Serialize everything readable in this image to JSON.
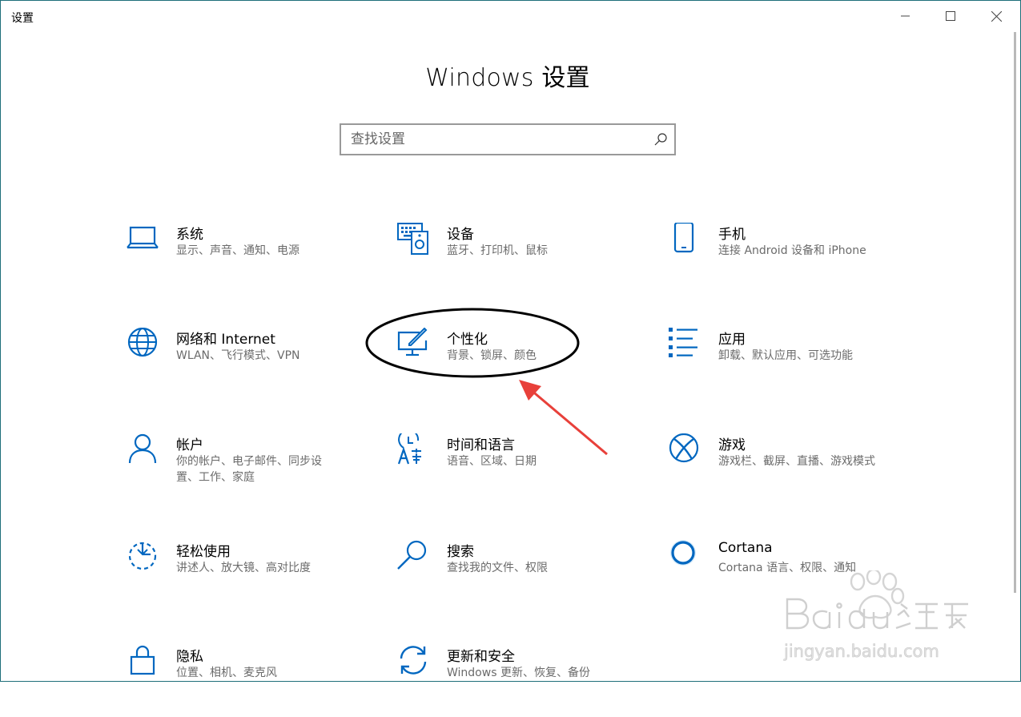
{
  "window": {
    "title": "设置",
    "controls": [
      "minimize-icon",
      "maximize-icon",
      "close-icon"
    ]
  },
  "page": {
    "title": "Windows 设置"
  },
  "search": {
    "placeholder": "查找设置",
    "value": ""
  },
  "colors": {
    "accent": "#0067c0",
    "annotation_ellipse": "#000000",
    "annotation_arrow": "#e8403a"
  },
  "tiles": [
    {
      "label": "系统",
      "desc": "显示、声音、通知、电源",
      "icon": "laptop-icon"
    },
    {
      "label": "设备",
      "desc": "蓝牙、打印机、鼠标",
      "icon": "keyboard-speaker-icon"
    },
    {
      "label": "手机",
      "desc": "连接 Android 设备和 iPhone",
      "icon": "phone-icon"
    },
    {
      "label": "网络和 Internet",
      "desc": "WLAN、飞行模式、VPN",
      "icon": "globe-icon"
    },
    {
      "label": "个性化",
      "desc": "背景、锁屏、颜色",
      "icon": "monitor-brush-icon"
    },
    {
      "label": "应用",
      "desc": "卸载、默认应用、可选功能",
      "icon": "app-list-icon"
    },
    {
      "label": "帐户",
      "desc": "你的帐户、电子邮件、同步设置、工作、家庭",
      "icon": "person-icon"
    },
    {
      "label": "时间和语言",
      "desc": "语音、区域、日期",
      "icon": "time-language-icon"
    },
    {
      "label": "游戏",
      "desc": "游戏栏、截屏、直播、游戏模式",
      "icon": "xbox-icon"
    },
    {
      "label": "轻松使用",
      "desc": "讲述人、放大镜、高对比度",
      "icon": "ease-of-access-icon"
    },
    {
      "label": "搜索",
      "desc": "查找我的文件、权限",
      "icon": "magnifier-icon"
    },
    {
      "label": "Cortana",
      "desc": "Cortana 语言、权限、通知",
      "icon": "cortana-icon"
    },
    {
      "label": "隐私",
      "desc": "位置、相机、麦克风",
      "icon": "lock-icon"
    },
    {
      "label": "更新和安全",
      "desc": "Windows 更新、恢复、备份",
      "icon": "refresh-icon"
    }
  ],
  "watermark": {
    "brand": "Bai du 经验",
    "url": "jingyan.baidu.com"
  }
}
